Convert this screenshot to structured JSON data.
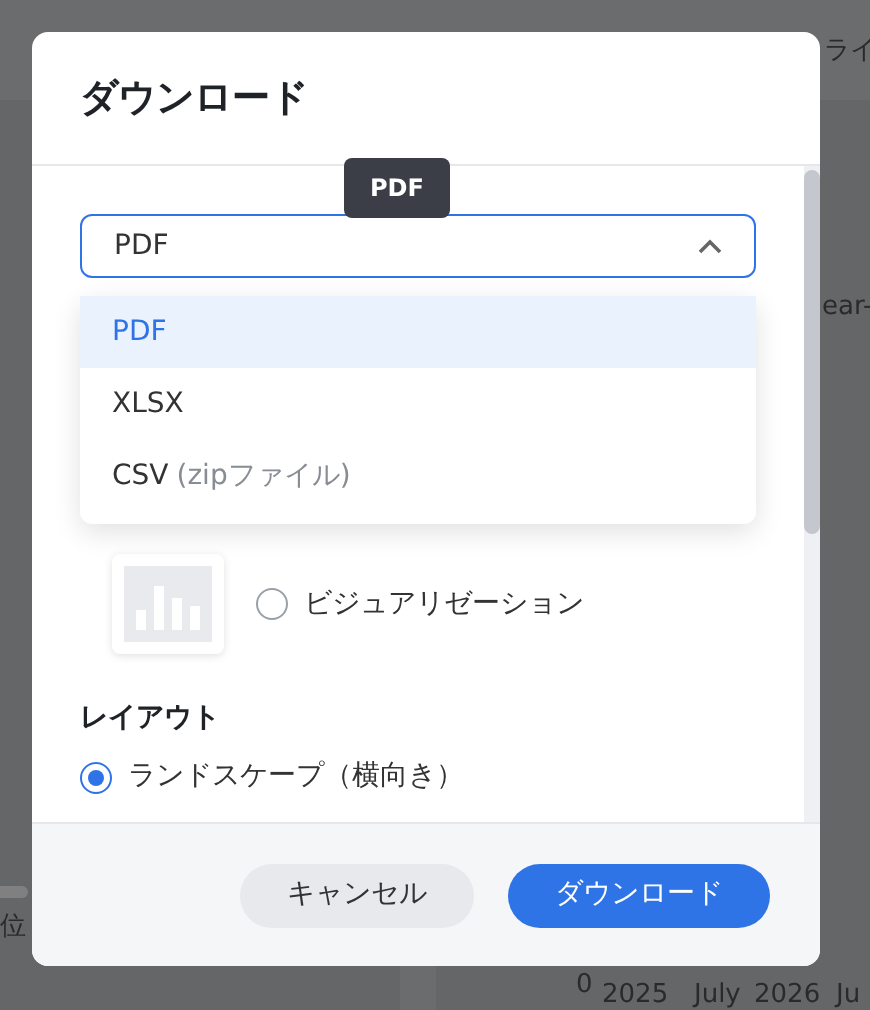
{
  "background": {
    "texts": [
      {
        "kind": "tab",
        "text": "ライ"
      },
      {
        "kind": "legend",
        "text": "ear-"
      },
      {
        "kind": "axis",
        "text": "位"
      },
      {
        "kind": "axis",
        "text": "0"
      },
      {
        "kind": "axis",
        "text": "2025"
      },
      {
        "kind": "axis",
        "text": "July"
      },
      {
        "kind": "axis",
        "text": "2026"
      },
      {
        "kind": "axis",
        "text": "Ju"
      }
    ]
  },
  "dialog": {
    "title": "ダウンロード",
    "tooltip": "PDF",
    "format_select": {
      "value": "PDF",
      "expanded": true,
      "options": [
        {
          "label": "PDF",
          "selected": true
        },
        {
          "label": "XLSX",
          "selected": false
        },
        {
          "label": "CSV",
          "hint": "(zipファイル)",
          "selected": false
        }
      ]
    },
    "content_options": [
      {
        "label": "ビジュアリゼーション",
        "selected": false
      }
    ],
    "layout": {
      "heading": "レイアウト",
      "options": [
        {
          "label": "ランドスケープ（横向き）",
          "selected": true
        }
      ]
    },
    "buttons": [
      {
        "kind": "secondary",
        "label": "キャンセル"
      },
      {
        "kind": "primary",
        "label": "ダウンロード"
      }
    ]
  }
}
